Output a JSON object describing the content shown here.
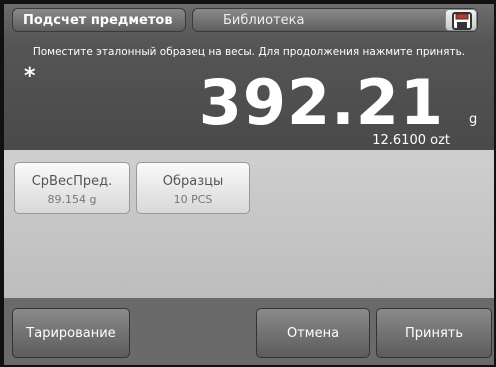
{
  "header": {
    "mode_label": "Подсчет предметов",
    "library_label": "Библиотека",
    "instruction": "Поместите эталонный образец на весы. Для продолжения нажмите принять.",
    "stability_mark": "*",
    "main_value": "392.21",
    "main_unit": "g",
    "secondary_reading": "12.6100 ozt"
  },
  "info": {
    "avg_piece_weight": {
      "title": "СрВесПред.",
      "value": "89.154 g"
    },
    "samples": {
      "title": "Образцы",
      "value": "10 PCS"
    }
  },
  "actions": {
    "tare": "Тарирование",
    "cancel": "Отмена",
    "accept": "Принять"
  },
  "icons": {
    "save": "save-floppy-icon"
  }
}
